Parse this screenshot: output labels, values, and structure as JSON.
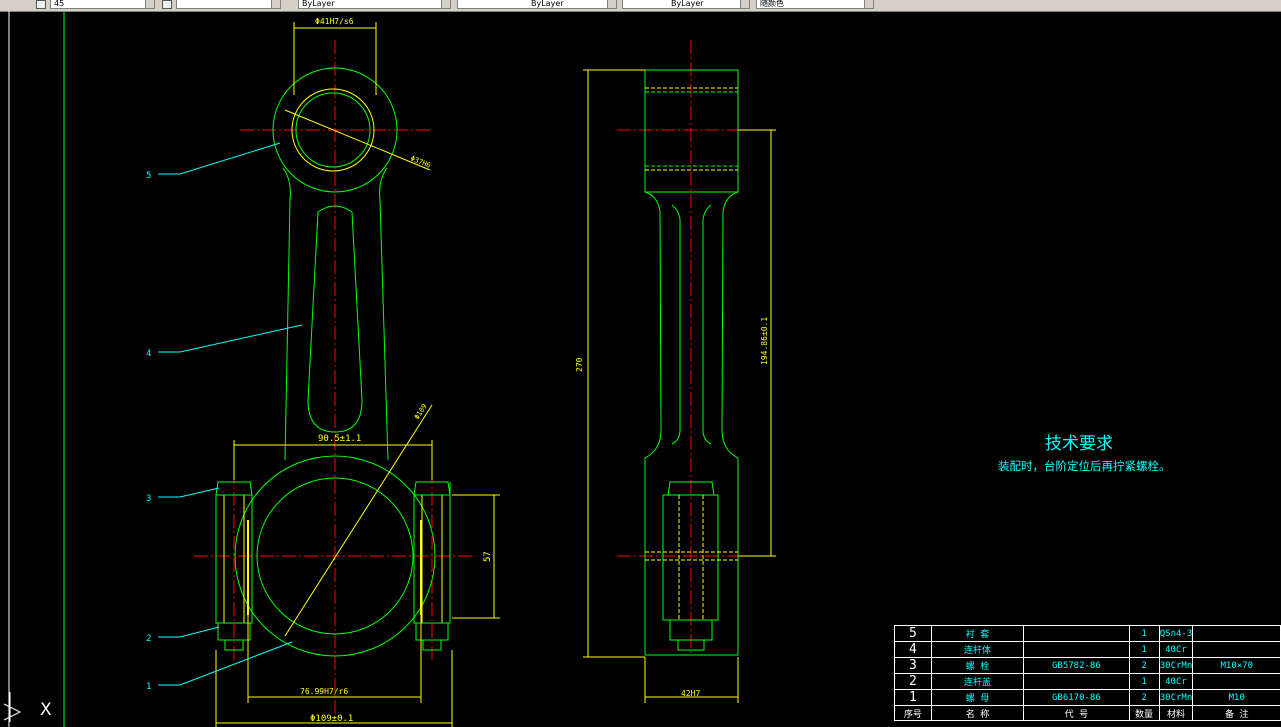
{
  "toolbar": {
    "layer_value": "45",
    "layer2_value": "",
    "color_value": "ByLayer",
    "linetype_value": "ByLayer",
    "lineweight_value": "ByLayer",
    "plotstyle_value": "随颜色"
  },
  "dimensions": {
    "small_end_bore": "Φ41H7/s6",
    "small_end_outer": "Φ37H6",
    "big_end_outer_dia": "Φ109±0.1",
    "big_end_bore": "76.99H7/r6",
    "bolt_center_distance": "90.5±1.1",
    "big_end_dia_leader": "Φ109",
    "bolt_height": "57",
    "overall_length": "270",
    "center_distance": "194.86±0.1",
    "width": "42H7"
  },
  "balloons": [
    "5",
    "4",
    "3",
    "2",
    "1"
  ],
  "technical_requirements": {
    "title": "技术要求",
    "text": "装配时，台阶定位后再拧紧螺栓。"
  },
  "bom": {
    "rows": [
      {
        "no": "5",
        "name": "衬  套",
        "code": "",
        "qty": "1",
        "material": "QSn4-3",
        "note": ""
      },
      {
        "no": "4",
        "name": "连杆体",
        "code": "",
        "qty": "1",
        "material": "40Cr",
        "note": ""
      },
      {
        "no": "3",
        "name": "螺  栓",
        "code": "GB5782-86",
        "qty": "2",
        "material": "30CrMn",
        "note": "M10×70"
      },
      {
        "no": "2",
        "name": "连杆盖",
        "code": "",
        "qty": "1",
        "material": "40Cr",
        "note": ""
      },
      {
        "no": "1",
        "name": "螺  母",
        "code": "GB6170-86",
        "qty": "2",
        "material": "30CrMn",
        "note": "M10"
      }
    ],
    "header": {
      "no": "序号",
      "name": "名    称",
      "code": "代    号",
      "qty": "数量",
      "material": "材料",
      "note": "备    注"
    }
  },
  "ucs": {
    "axis_label": "X"
  },
  "colors": {
    "background": "#000000",
    "outline": "#00ff00",
    "centerline": "#ff0000",
    "dimension": "#ffff00",
    "leader": "#00ffff",
    "text": "#00ffff"
  }
}
